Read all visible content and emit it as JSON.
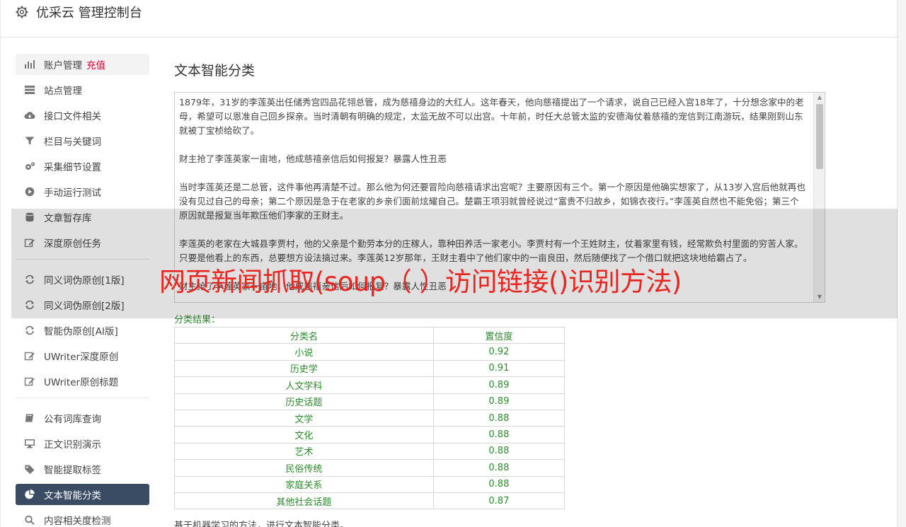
{
  "header": {
    "title": "优采云 管理控制台",
    "icon": "gear-icon"
  },
  "sidebar": {
    "items": [
      {
        "label": "账户管理",
        "extra": "充值",
        "icon": "bar-chart-icon"
      },
      {
        "label": "站点管理",
        "icon": "server-icon"
      },
      {
        "label": "接口文件相关",
        "icon": "cloud-upload-icon"
      },
      {
        "label": "栏目与关键词",
        "icon": "filter-icon"
      },
      {
        "label": "采集细节设置",
        "icon": "gears-icon"
      },
      {
        "label": "手动运行测试",
        "icon": "play-circle-icon"
      },
      {
        "label": "文章暂存库",
        "icon": "database-icon"
      },
      {
        "label": "深度原创任务",
        "icon": "edit-icon"
      },
      {
        "label": "同义词伪原创[1版]",
        "icon": "refresh-icon"
      },
      {
        "label": "同义词伪原创[2版]",
        "icon": "refresh-icon"
      },
      {
        "label": "智能伪原创[AI版]",
        "icon": "refresh-icon"
      },
      {
        "label": "UWriter深度原创",
        "icon": "edit-icon"
      },
      {
        "label": "UWriter原创标题",
        "icon": "edit-icon"
      },
      {
        "label": "公有词库查询",
        "icon": "book-icon"
      },
      {
        "label": "正文识别演示",
        "icon": "monitor-icon"
      },
      {
        "label": "智能提取标签",
        "icon": "tag-icon"
      },
      {
        "label": "文本智能分类",
        "icon": "pie-chart-icon"
      },
      {
        "label": "内容相关度检测",
        "icon": "search-icon"
      }
    ]
  },
  "main": {
    "title": "文本智能分类",
    "text_paragraphs": [
      "1879年，31岁的李莲英出任储秀宫四品花翎总管，成为慈禧身边的大红人。这年春天，他向慈禧提出了一个请求，说自己已经入宫18年了，十分想念家中的老母，希望可以恩准自己回乡探亲。当时清朝有明确的规定，太监无故不可以出宫。十年前，时任大总管太监的安德海仗着慈禧的宠信到江南游玩，结果刚到山东就被丁宝桢给砍了。",
      "财主抢了李莲英家一亩地，他成慈禧亲信后如何报复？暴露人性丑恶",
      "当时李莲英还是二总管，这件事他再清楚不过。那么他为何还要冒险向慈禧请求出宫呢？主要原因有三个。第一个原因是他确实想家了，从13岁入宫后他就再也没有见过自己的母亲；第二个原因是急于在老家的乡亲们面前炫耀自己。楚霸王项羽就曾经说过“富贵不归故乡，如锦衣夜行。”李莲英自然也不能免俗；第三个原因就是报复当年欺压他们李家的王财主。",
      "李莲英的老家在大城县李贾村，他的父亲是个勤劳本分的庄稼人，靠种田养活一家老小。李贾村有一个王姓财主，仗着家里有钱，经常欺负村里面的穷苦人家。只要是他看上的东西，总要想方设法搞过来。李莲英12岁那年，王财主看中了他们家中的一亩良田，然后随便找了一个借口就把这块地给霸占了。",
      "财主抢了李莲英家一亩地，他成慈禧亲信后如何报复？暴露人性丑恶"
    ],
    "result_label": "分类结果：",
    "table": {
      "headers": [
        "分类名",
        "置信度"
      ],
      "rows": [
        [
          "小说",
          "0.92"
        ],
        [
          "历史学",
          "0.91"
        ],
        [
          "人文学科",
          "0.89"
        ],
        [
          "历史话题",
          "0.89"
        ],
        [
          "文学",
          "0.88"
        ],
        [
          "文化",
          "0.88"
        ],
        [
          "艺术",
          "0.88"
        ],
        [
          "民俗传统",
          "0.88"
        ],
        [
          "家庭关系",
          "0.88"
        ],
        [
          "其他社会话题",
          "0.87"
        ]
      ]
    },
    "footnote": "基于机器学习的方法，进行文本智能分类。"
  },
  "overlay": {
    "title": "网页新闻抓取(soup（ ）访问链接()识别方法)"
  },
  "colors": {
    "active_nav_bg": "#3a4c63",
    "recharge_red": "#d9002e",
    "result_green": "#2c8a2c",
    "overlay_red": "#e8251e"
  }
}
